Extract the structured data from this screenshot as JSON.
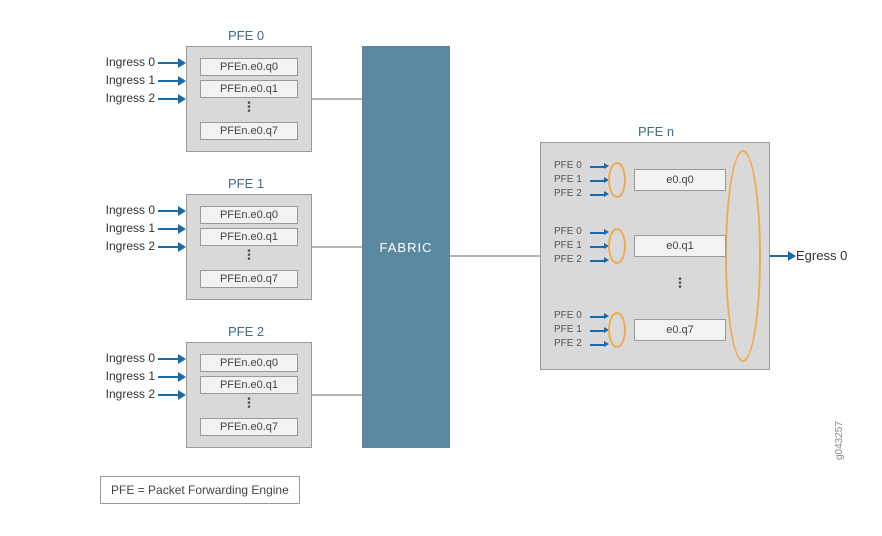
{
  "ingress_pfes": [
    {
      "title": "PFE 0",
      "queues": [
        "PFEn.e0.q0",
        "PFEn.e0.q1",
        "PFEn.e0.q7"
      ],
      "inputs": [
        "Ingress 0",
        "Ingress 1",
        "Ingress 2"
      ]
    },
    {
      "title": "PFE 1",
      "queues": [
        "PFEn.e0.q0",
        "PFEn.e0.q1",
        "PFEn.e0.q7"
      ],
      "inputs": [
        "Ingress 0",
        "Ingress 1",
        "Ingress 2"
      ]
    },
    {
      "title": "PFE 2",
      "queues": [
        "PFEn.e0.q0",
        "PFEn.e0.q1",
        "PFEn.e0.q7"
      ],
      "inputs": [
        "Ingress 0",
        "Ingress 1",
        "Ingress 2"
      ]
    }
  ],
  "fabric_label": "FABRIC",
  "egress_pfe": {
    "title": "PFE n",
    "groups": [
      {
        "sources": [
          "PFE 0",
          "PFE 1",
          "PFE 2"
        ],
        "queue": "e0.q0"
      },
      {
        "sources": [
          "PFE 0",
          "PFE 1",
          "PFE 2"
        ],
        "queue": "e0.q1"
      },
      {
        "sources": [
          "PFE 0",
          "PFE 1",
          "PFE 2"
        ],
        "queue": "e0.q7"
      }
    ],
    "output": "Egress 0"
  },
  "legend": "PFE = Packet Forwarding Engine",
  "figure_id": "g043257"
}
